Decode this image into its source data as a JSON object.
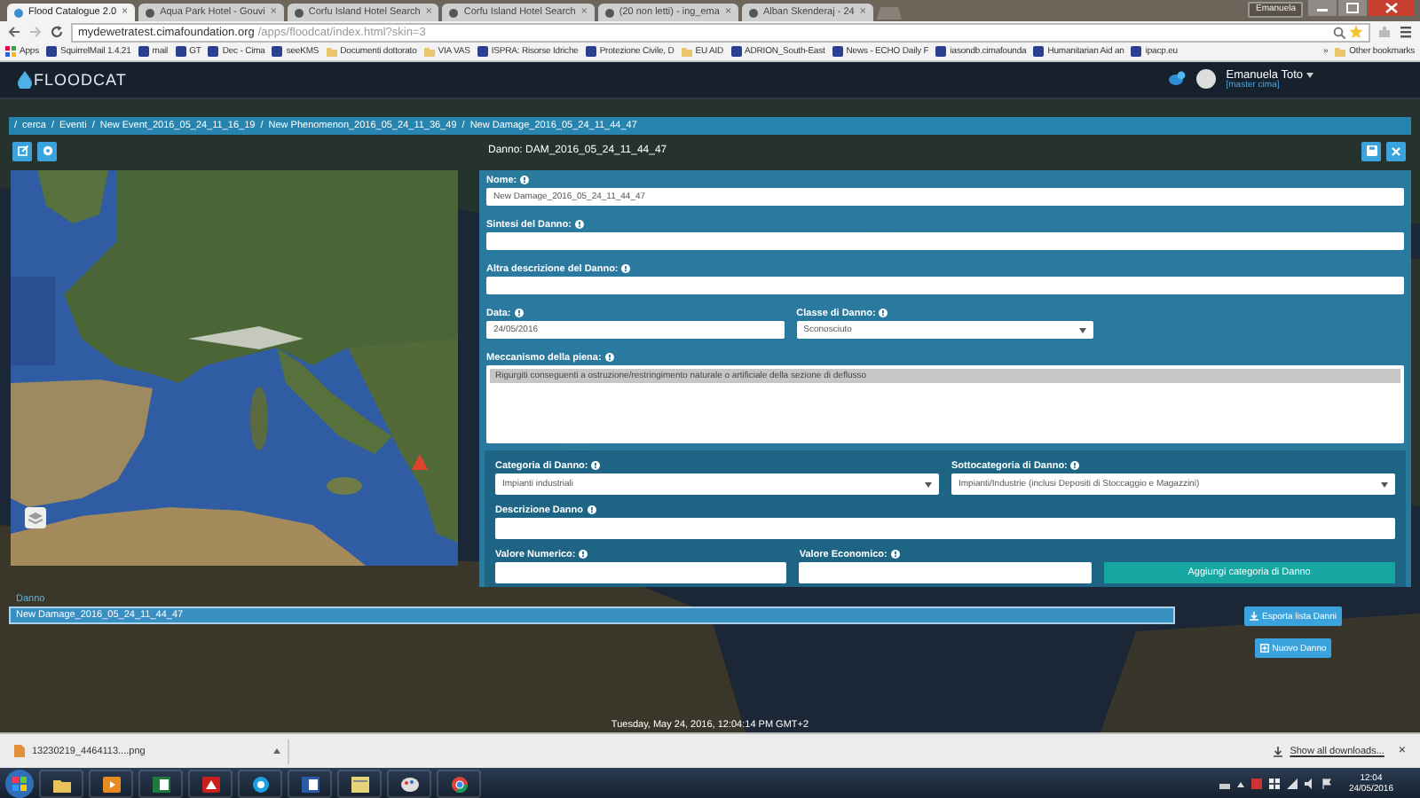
{
  "browser": {
    "tabs": [
      {
        "title": "Flood Catalogue 2.0",
        "close": "×",
        "selected": true
      },
      {
        "title": "Aqua Park Hotel - Gouvi",
        "close": "×",
        "selected": false
      },
      {
        "title": "Corfu Island Hotel Search",
        "close": "×",
        "selected": false
      },
      {
        "title": "Corfu Island Hotel Search",
        "close": "×",
        "selected": false
      },
      {
        "title": "(20 non letti) - ing_ema",
        "close": "×",
        "selected": false
      },
      {
        "title": "Alban Skenderaj - 24",
        "close": "×",
        "selected": false
      }
    ],
    "profile": "Emanuela",
    "url_host": "mydewetratest.cimafoundation.org",
    "url_path": "/apps/floodcat/index.html?skin=3",
    "bookmarks": [
      {
        "label": "Apps",
        "kind": "apps"
      },
      {
        "label": "SquirrelMail 1.4.21",
        "kind": "page"
      },
      {
        "label": "mail",
        "kind": "page"
      },
      {
        "label": "GT",
        "kind": "page"
      },
      {
        "label": "Dec - Cima",
        "kind": "page"
      },
      {
        "label": "seeKMS",
        "kind": "page"
      },
      {
        "label": "Documenti dottorato",
        "kind": "folder"
      },
      {
        "label": "VIA VAS",
        "kind": "folder"
      },
      {
        "label": "ISPRA: Risorse Idriche",
        "kind": "page"
      },
      {
        "label": "Protezione Civile, D",
        "kind": "page"
      },
      {
        "label": "EU AID",
        "kind": "folder"
      },
      {
        "label": "ADRION_South-East",
        "kind": "page"
      },
      {
        "label": "News - ECHO Daily F",
        "kind": "page"
      },
      {
        "label": "iasondb.cimafounda",
        "kind": "page"
      },
      {
        "label": "Humanitarian Aid an",
        "kind": "page"
      },
      {
        "label": "ipacp.eu",
        "kind": "page"
      },
      {
        "label": "»",
        "kind": "more"
      },
      {
        "label": "Other bookmarks",
        "kind": "folder"
      }
    ]
  },
  "app": {
    "logo": "FLOODCAT",
    "user": {
      "name": "Emanuela Toto",
      "role": "[master cima]"
    }
  },
  "breadcrumb": {
    "separator": "/",
    "items": [
      "cerca",
      "Eventi",
      "New Event_2016_05_24_11_16_19",
      "New Phenomenon_2016_05_24_11_36_49",
      "New Damage_2016_05_24_11_44_47"
    ]
  },
  "detail_title": "Danno: DAM_2016_05_24_11_44_47",
  "form": {
    "sections": [
      {
        "kind": "main",
        "rows": [
          [
            {
              "label": "Nome:",
              "kind": "text",
              "help": true,
              "value": "New Damage_2016_05_24_11_44_47"
            }
          ],
          [
            {
              "label": "Sintesi del Danno:",
              "kind": "text",
              "help": true
            }
          ],
          [
            {
              "label": "Altra descrizione del Danno:",
              "kind": "text",
              "help": true
            }
          ],
          [
            {
              "label": "Data:",
              "kind": "text",
              "help": true,
              "value": "24/05/2016"
            },
            {
              "label": "Classe di Danno:",
              "kind": "select",
              "help": true,
              "value": "Sconosciuto"
            }
          ],
          [
            {
              "label": "Meccanismo della piena:",
              "kind": "listbox",
              "help": true,
              "options": [
                {
                  "label": "Rigurgiti conseguenti a ostruzione/restringimento naturale o artificiale della sezione di deflusso",
                  "selected": true
                }
              ]
            }
          ]
        ]
      },
      {
        "kind": "sub",
        "rows": [
          [
            {
              "label": "Categoria di Danno:",
              "kind": "select",
              "help": true,
              "value": "Impianti industriali"
            },
            {
              "label": "Sottocategoria di Danno:",
              "kind": "select",
              "help": true,
              "value": "Impianti/Industrie (inclusi Depositi di Stoccaggio e Magazzini)"
            }
          ],
          [
            {
              "label": "Descrizione Danno",
              "kind": "text",
              "help": true
            }
          ],
          [
            {
              "label": "Valore Numerico:",
              "kind": "text",
              "help": true
            },
            {
              "label": "Valore Economico:",
              "kind": "text",
              "help": true
            },
            {
              "label": "Aggiungi categoria di Danno",
              "kind": "button"
            }
          ]
        ]
      }
    ]
  },
  "damage_list": {
    "title": "Danno",
    "items": [
      "New Damage_2016_05_24_11_44_47"
    ]
  },
  "actions": [
    {
      "label": "Esporta lista Danni",
      "kind": "export"
    },
    {
      "label": "Nuovo Danno",
      "kind": "new"
    }
  ],
  "status_time": "Tuesday, May 24, 2016, 12:04:14 PM GMT+2",
  "downloads": {
    "file": "13230219_4464113....png",
    "show_all": "Show all downloads...",
    "close": "×"
  },
  "taskbar": {
    "time": "12:04",
    "date": "24/05/2016"
  }
}
